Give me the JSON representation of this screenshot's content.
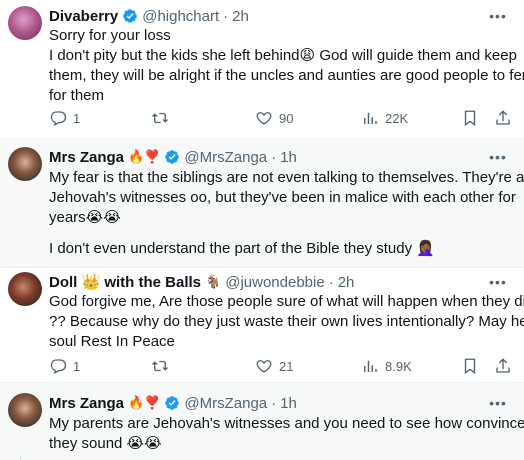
{
  "tweets": [
    {
      "name": "Divaberry",
      "emoji": "",
      "handle": "@highchart",
      "time": "2h",
      "lines": [
        "Sorry for your loss",
        "I don't pity but the kids she left behind😩 God will guide them and keep",
        "them, they will be alright if the uncles and aunties are good people to fend",
        "for them"
      ],
      "replies": "1",
      "retweets": "",
      "likes": "90",
      "views": "22K"
    },
    {
      "name": "Mrs Zanga",
      "emoji": "🔥❣️",
      "handle": "@MrsZanga",
      "time": "1h",
      "lines": [
        "My fear is that the siblings are not even talking to themselves. They're all",
        "Jehovah's witnesses oo, but they've been in malice with each other for",
        "years😭😭",
        "",
        "I don't even understand the part of the Bible they study 🤦🏾‍♀️"
      ]
    },
    {
      "name": "Doll 👑 with the Balls",
      "emoji": "🐐",
      "handle": "@juwondebbie",
      "time": "2h",
      "lines": [
        "God forgive me, Are those people sure of what will happen when they die,",
        "?? Because why do they just waste their own lives intentionally? May her",
        "soul Rest In Peace"
      ],
      "replies": "1",
      "retweets": "",
      "likes": "21",
      "views": "8.9K"
    },
    {
      "name": "Mrs Zanga",
      "emoji": "🔥❣️",
      "handle": "@MrsZanga",
      "time": "1h",
      "lines": [
        "My parents are Jehovah's witnesses and you need to see how convinced",
        "they sound 😭😭"
      ]
    }
  ],
  "colors": {
    "verified": "#1d9bf0",
    "muted": "#536471",
    "text": "#0f1419"
  },
  "icons": [
    "verified-badge-icon",
    "more-icon",
    "reply-icon",
    "retweet-icon",
    "like-icon",
    "views-icon",
    "bookmark-icon",
    "share-icon"
  ]
}
